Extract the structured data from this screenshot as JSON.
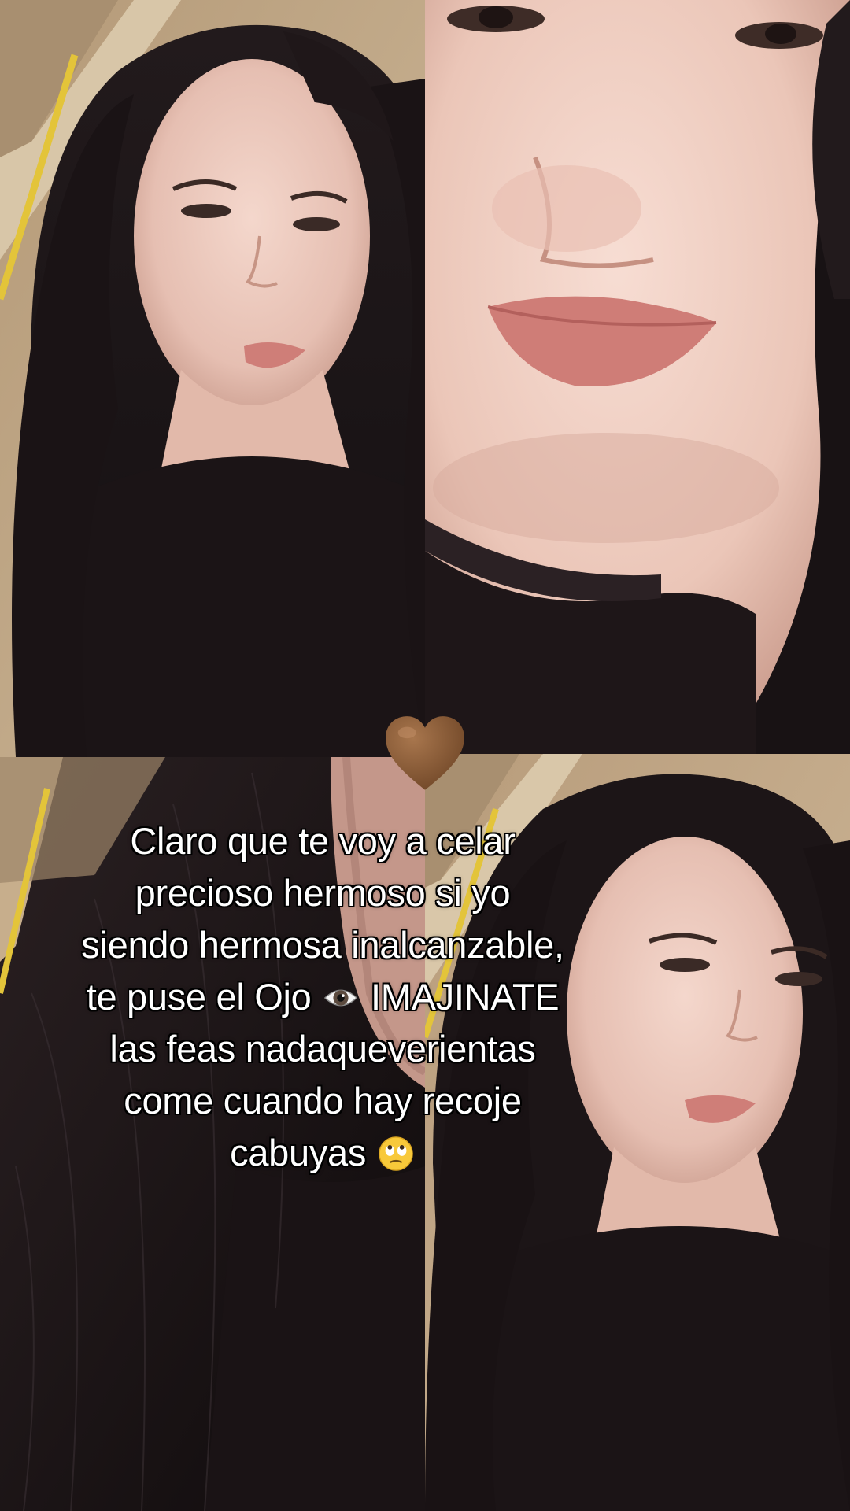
{
  "caption": {
    "lines": [
      "Claro que te voy a celar",
      "precioso hermoso si yo",
      "siendo hermosa inalcanzable,",
      "te puse el Ojo",
      "IMAJINATE",
      "las feas nadaqueverientas",
      "come cuando hay recoje",
      "cabuyas"
    ]
  },
  "icons": {
    "heart": "brown-heart-icon",
    "eye": "eye-icon",
    "eye_roll": "eye-roll-face-icon"
  },
  "colors": {
    "heart": "#8a5a35",
    "caption_text": "#ffffff",
    "caption_outline": "#000000"
  }
}
